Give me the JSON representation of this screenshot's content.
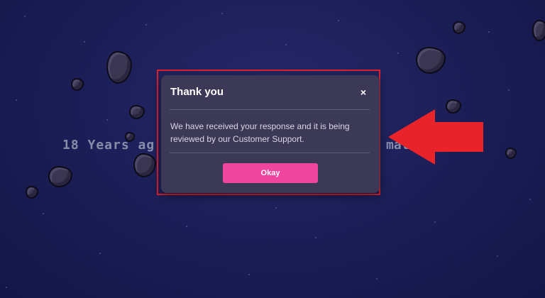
{
  "background": {
    "partial_text": "18 Years ag",
    "partial_text_right": "mal"
  },
  "modal": {
    "title": "Thank you",
    "close_glyph": "×",
    "message": "We have received your response and it is being reviewed by our Customer Support.",
    "okay_label": "Okay"
  },
  "colors": {
    "background": "#1c1f58",
    "modal_background": "#3b3955",
    "button": "#f0459f",
    "highlight": "#e0202a",
    "arrow": "#e8232a"
  },
  "icons": {
    "close": "close-icon",
    "arrow": "arrow-left-icon"
  }
}
